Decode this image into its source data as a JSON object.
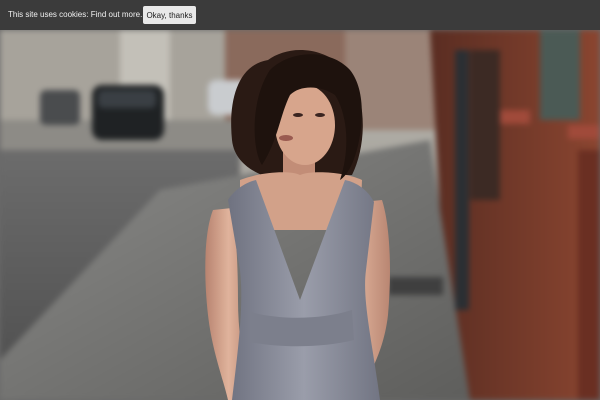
{
  "cookie_bar": {
    "message": "This site uses cookies:",
    "link_text": "Find out more.",
    "button_label": "Okay, thanks"
  },
  "colors": {
    "cookie_bar_bg": "#3b3b3b",
    "button_bg": "#e9e9e9",
    "dress": "#8c8f9b",
    "brick": "#7a3e2c"
  }
}
